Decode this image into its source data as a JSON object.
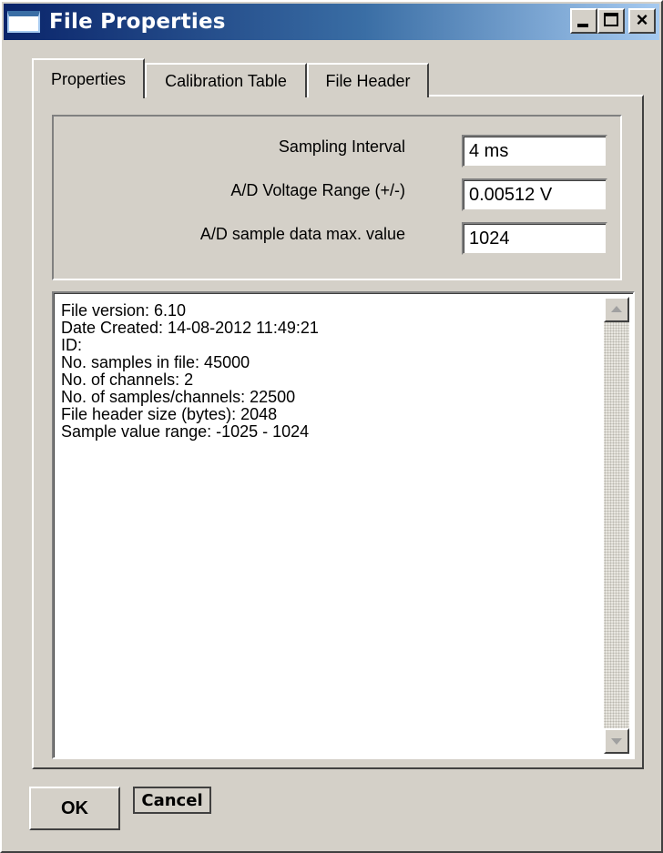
{
  "window": {
    "title": "File Properties",
    "buttons": {
      "minimize": "_",
      "maximize": "□",
      "close": "×"
    }
  },
  "tabs": [
    {
      "label": "Properties",
      "active": true
    },
    {
      "label": "Calibration Table",
      "active": false
    },
    {
      "label": "File Header",
      "active": false
    }
  ],
  "fields": {
    "sampling_interval": {
      "label": "Sampling Interval",
      "value": "4 ms"
    },
    "voltage_range": {
      "label": "A/D Voltage Range (+/-)",
      "value": "0.00512 V"
    },
    "max_value": {
      "label": "A/D sample data max. value",
      "value": "1024"
    }
  },
  "memo": {
    "lines": [
      "File version: 6.10",
      "Date Created: 14-08-2012 11:49:21",
      "ID:",
      "No. samples in file: 45000",
      "No. of channels: 2",
      "No. of samples/channels: 22500",
      "File header size (bytes): 2048",
      "Sample value range: -1025 - 1024"
    ]
  },
  "footer": {
    "ok_label": "OK",
    "cancel_label": "Cancel"
  },
  "icons": {
    "app": "window-app-icon",
    "scroll_up": "arrow-up-icon",
    "scroll_down": "arrow-down-icon"
  },
  "colors": {
    "titlebar_start": "#0a246a",
    "titlebar_end": "#a6caf0",
    "face": "#d4d0c8"
  }
}
